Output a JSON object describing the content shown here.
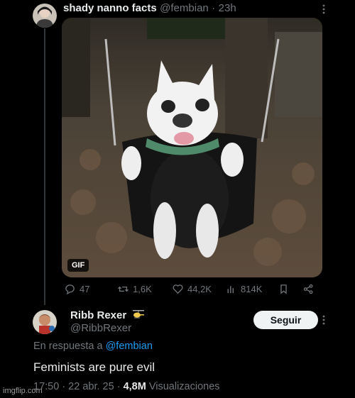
{
  "post": {
    "author_name": "shady nanno facts",
    "handle": "@fembian",
    "separator": "·",
    "time": "23h",
    "gif_label": "GIF",
    "stats": {
      "replies": "47",
      "reposts": "1,6K",
      "likes": "44,2K",
      "views": "814K"
    }
  },
  "reply": {
    "author_name": "Ribb Rexer",
    "handle": "@RibbRexer",
    "follow_label": "Seguir",
    "reply_prefix": "En respuesta a",
    "reply_to": "@fembian",
    "text": "Feminists are pure evil",
    "timestamp": "17:50 · 22 abr. 25 ·",
    "views_count": "4,8M",
    "views_label": "Visualizaciones"
  },
  "watermark": "imgflip.com",
  "colors": {
    "background": "#000000",
    "accent": "#1d9bf0",
    "muted": "#71767b",
    "text": "#e7e9ea"
  }
}
